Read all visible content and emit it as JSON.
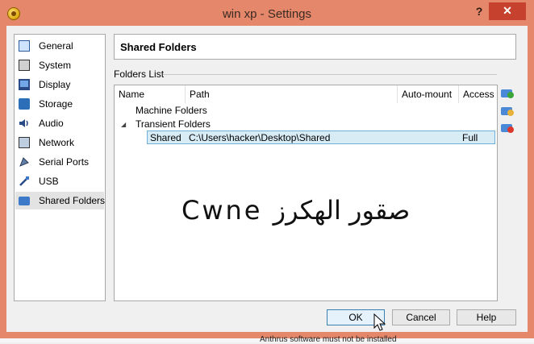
{
  "window": {
    "title": "win xp - Settings",
    "help_glyph": "?",
    "close_glyph": "✕",
    "bottom_strip_text": "Anthrus software must not be installed"
  },
  "sidebar": {
    "items": [
      {
        "label": "General",
        "icon": "general-icon"
      },
      {
        "label": "System",
        "icon": "system-icon"
      },
      {
        "label": "Display",
        "icon": "display-icon"
      },
      {
        "label": "Storage",
        "icon": "storage-icon"
      },
      {
        "label": "Audio",
        "icon": "audio-icon"
      },
      {
        "label": "Network",
        "icon": "network-icon"
      },
      {
        "label": "Serial Ports",
        "icon": "serial-ports-icon"
      },
      {
        "label": "USB",
        "icon": "usb-icon"
      },
      {
        "label": "Shared Folders",
        "icon": "shared-folders-icon",
        "selected": true
      }
    ]
  },
  "header": {
    "title": "Shared Folders"
  },
  "folders": {
    "section_label": "Folders List",
    "columns": [
      "Name",
      "Path",
      "Auto-mount",
      "Access"
    ],
    "groups": [
      {
        "label": "Machine Folders",
        "expanded": false
      },
      {
        "label": "Transient Folders",
        "expanded": true
      }
    ],
    "rows": [
      {
        "name": "Shared",
        "path": "C:\\Users\\hacker\\Desktop\\Shared",
        "auto_mount": "",
        "access": "Full"
      }
    ],
    "tree_arrow": "◢"
  },
  "watermark": {
    "text": "Cwne صقور الهكرز"
  },
  "buttons": {
    "ok": "OK",
    "cancel": "Cancel",
    "help": "Help"
  },
  "colors": {
    "frame": "#e5876a",
    "close": "#c7412f",
    "selection": "#d8ecf6",
    "accent": "#3c7fb1"
  }
}
